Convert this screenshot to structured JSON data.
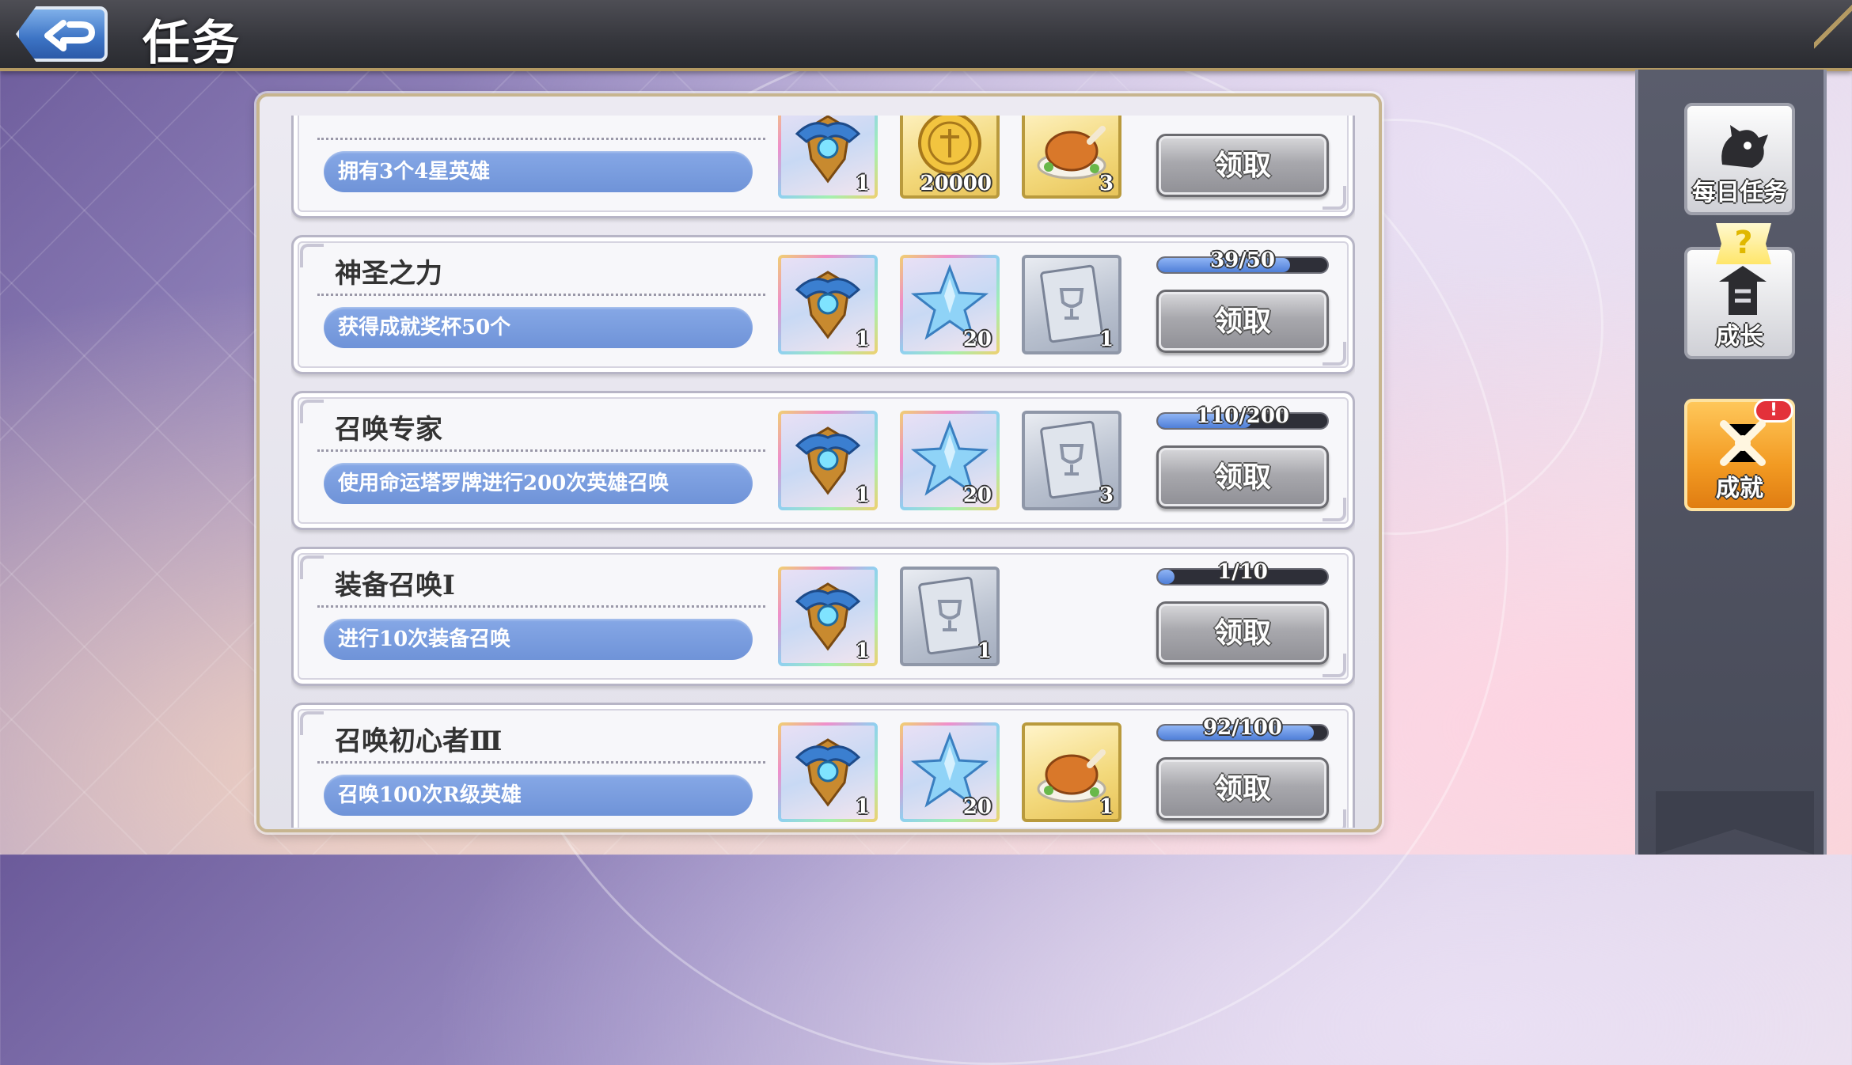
{
  "header": {
    "title": "任务"
  },
  "tasks": [
    {
      "title": "",
      "description": "拥有3个4星英雄",
      "progress_text": "",
      "progress_fraction": null,
      "claim_label": "领取",
      "rewards": [
        {
          "item": "hero-crest-icon",
          "quantity": "1"
        },
        {
          "item": "gold-coin-icon",
          "quantity": "20000"
        },
        {
          "item": "roast-chicken-icon",
          "quantity": "3"
        }
      ]
    },
    {
      "title": "神圣之力",
      "description": "获得成就奖杯50个",
      "progress_text": "39/50",
      "progress_fraction": 0.78,
      "claim_label": "领取",
      "rewards": [
        {
          "item": "hero-crest-icon",
          "quantity": "1"
        },
        {
          "item": "crystal-star-icon",
          "quantity": "20"
        },
        {
          "item": "trophy-card-icon",
          "quantity": "1"
        }
      ]
    },
    {
      "title": "召唤专家",
      "description": "使用命运塔罗牌进行200次英雄召唤",
      "progress_text": "110/200",
      "progress_fraction": 0.55,
      "claim_label": "领取",
      "rewards": [
        {
          "item": "hero-crest-icon",
          "quantity": "1"
        },
        {
          "item": "crystal-star-icon",
          "quantity": "20"
        },
        {
          "item": "trophy-card-icon",
          "quantity": "3"
        }
      ]
    },
    {
      "title": "装备召唤Ⅰ",
      "description": "进行10次装备召唤",
      "progress_text": "1/10",
      "progress_fraction": 0.1,
      "claim_label": "领取",
      "rewards": [
        {
          "item": "hero-crest-icon",
          "quantity": "1"
        },
        {
          "item": "trophy-card-icon",
          "quantity": "1"
        }
      ]
    },
    {
      "title": "召唤初心者Ⅲ",
      "description": "召唤100次R级英雄",
      "progress_text": "92/100",
      "progress_fraction": 0.92,
      "claim_label": "领取",
      "rewards": [
        {
          "item": "hero-crest-icon",
          "quantity": "1"
        },
        {
          "item": "crystal-star-icon",
          "quantity": "20"
        },
        {
          "item": "roast-chicken-icon",
          "quantity": "1"
        }
      ]
    }
  ],
  "side_tabs": [
    {
      "label": "每日任务",
      "icon": "daily-quest-icon",
      "active": false,
      "badge": ""
    },
    {
      "label": "成长",
      "icon": "growth-icon",
      "active": false,
      "badge": "?"
    },
    {
      "label": "成就",
      "icon": "achievement-icon",
      "active": true,
      "badge": "!"
    }
  ],
  "colors": {
    "header_bg": "#35363c",
    "accent_gold": "#b49a63",
    "desc_blue": "#7b9de0",
    "progress_blue": "#4f7fd8",
    "active_tab_orange": "#f29a22",
    "alert_red": "#e3313a"
  }
}
